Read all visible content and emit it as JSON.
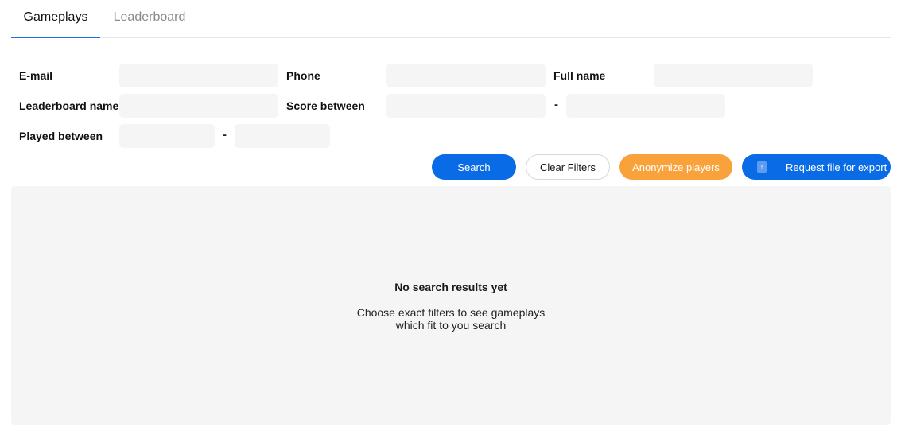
{
  "tabs": [
    {
      "label": "Gameplays",
      "active": true
    },
    {
      "label": "Leaderboard",
      "active": false
    }
  ],
  "filters": {
    "email_label": "E-mail",
    "phone_label": "Phone",
    "fullname_label": "Full name",
    "leaderboard_name_label": "Leaderboard name",
    "score_between_label": "Score between",
    "played_between_label": "Played between",
    "range_separator": "-",
    "values": {
      "email": "",
      "phone": "",
      "fullname": "",
      "leaderboard_name": "",
      "score_from": "",
      "score_to": "",
      "played_from": "",
      "played_to": ""
    }
  },
  "actions": {
    "search_label": "Search",
    "clear_label": "Clear Filters",
    "anonymize_label": "Anonymize players",
    "export_label": "Request file for export"
  },
  "results": {
    "empty_title": "No search results yet",
    "empty_line1": "Choose exact filters to see gameplays",
    "empty_line2": "which fit to you search"
  },
  "colors": {
    "primary": "#0a6be6",
    "warning": "#f9a23b",
    "input_bg": "#f5f5f5"
  },
  "icons": {
    "export": "upload-file-icon"
  }
}
